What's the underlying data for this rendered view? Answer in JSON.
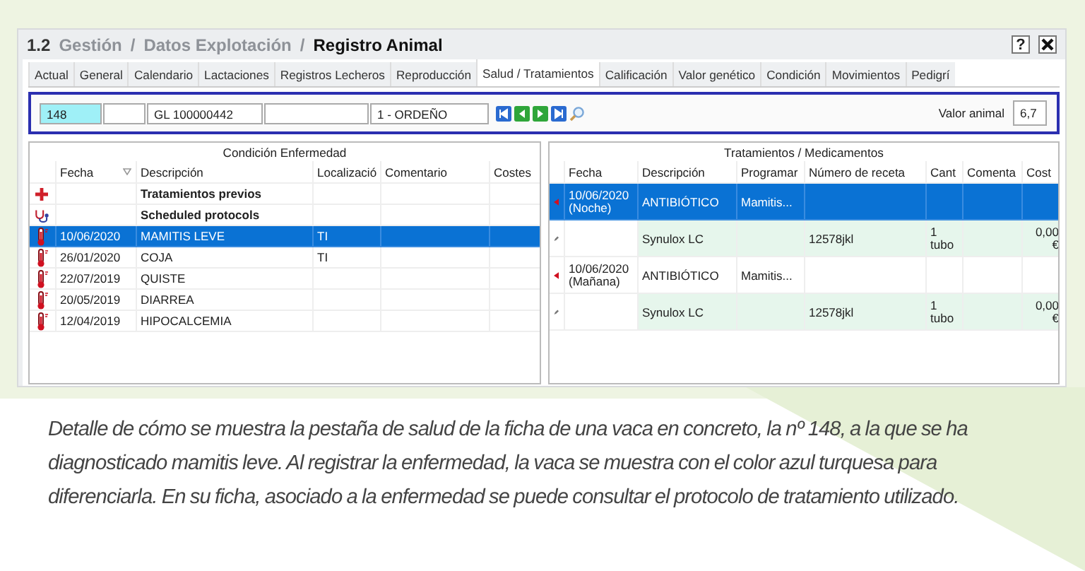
{
  "window": {
    "title": {
      "number": "1.2",
      "crumbs": [
        "Gestión",
        "Datos Explotación"
      ],
      "separator": "/",
      "current": "Registro Animal"
    },
    "help_button": "?"
  },
  "tabs": [
    {
      "label": "Actual",
      "selected": false
    },
    {
      "label": "General",
      "selected": false
    },
    {
      "label": "Calendario",
      "selected": false
    },
    {
      "label": "Lactaciones",
      "selected": false
    },
    {
      "label": "Registros Lecheros",
      "selected": false
    },
    {
      "label": "Reproducción",
      "selected": false
    },
    {
      "label": "Salud / Tratamientos",
      "selected": true
    },
    {
      "label": "Calificación",
      "selected": false
    },
    {
      "label": "Valor genético",
      "selected": false
    },
    {
      "label": "Condición",
      "selected": false
    },
    {
      "label": "Movimientos",
      "selected": false
    },
    {
      "label": "Pedigrí",
      "selected": false
    }
  ],
  "toolbar": {
    "fields": [
      {
        "value": "148",
        "highlighted": true
      },
      {
        "highlighted": false
      },
      {
        "value": "GL 100000442",
        "highlighted": false
      },
      {
        "highlighted": false
      },
      {
        "value": "1 - ORDEÑO",
        "highlighted": false
      }
    ],
    "nav_buttons": [
      {
        "kind": "first"
      },
      {
        "kind": "prev"
      },
      {
        "kind": "next"
      },
      {
        "kind": "last"
      },
      {
        "kind": "search"
      }
    ],
    "value_label": "Valor animal",
    "value": "6,7"
  },
  "left_grid": {
    "title": "Condición Enfermedad",
    "columns": [
      "Fecha",
      "Descripción",
      "Localizació",
      "Comentario",
      "Costes"
    ],
    "rows": [
      {
        "kind": "previous",
        "description": "Tratamientos previos",
        "selected": false
      },
      {
        "kind": "protocol",
        "description": "Scheduled protocols",
        "selected": false
      },
      {
        "kind": "disease",
        "date": "10/06/2020",
        "description": "MAMITIS LEVE",
        "location": "TI",
        "selected": true
      },
      {
        "kind": "disease",
        "date": "26/01/2020",
        "description": "COJA",
        "location": "TI",
        "selected": false
      },
      {
        "kind": "disease",
        "date": "22/07/2019",
        "description": "QUISTE",
        "selected": false
      },
      {
        "kind": "disease",
        "date": "20/05/2019",
        "description": "DIARREA",
        "selected": false
      },
      {
        "kind": "disease",
        "date": "12/04/2019",
        "description": "HIPOCALCEMIA",
        "selected": false
      }
    ]
  },
  "right_grid": {
    "title": "Tratamientos / Medicamentos",
    "columns": [
      "Fecha",
      "Descripción",
      "Programar",
      "Número de receta",
      "Cant",
      "Comenta",
      "Cost"
    ],
    "rows": [
      {
        "kind": "treatment",
        "date": "10/06/2020",
        "shift": "(Noche)",
        "description": "ANTIBIÓTICO",
        "program": "Mamitis...",
        "selected": true
      },
      {
        "kind": "medicine",
        "description": "Synulox LC",
        "prescription": "12578jkl",
        "quantity": "1",
        "unit": "tubo",
        "cost": "0,00",
        "currency": "€",
        "selected": false
      },
      {
        "kind": "treatment",
        "date": "10/06/2020",
        "shift": "(Mañana)",
        "description": "ANTIBIÓTICO",
        "program": "Mamitis...",
        "selected": false
      },
      {
        "kind": "medicine",
        "description": "Synulox LC",
        "prescription": "12578jkl",
        "quantity": "1",
        "unit": "tubo",
        "cost": "0,00",
        "currency": "€",
        "selected": false
      }
    ]
  },
  "caption": "Detalle de cómo se muestra la pestaña de salud de la ficha de una vaca en concreto, la nº 148, a la que se ha diagnosticado mamitis leve. Al registrar la enfermedad, la vaca se muestra con el color azul turquesa para diferenciarla. En su ficha, asociado a la enfermedad se puede consultar el protocolo de tratamiento utilizado."
}
